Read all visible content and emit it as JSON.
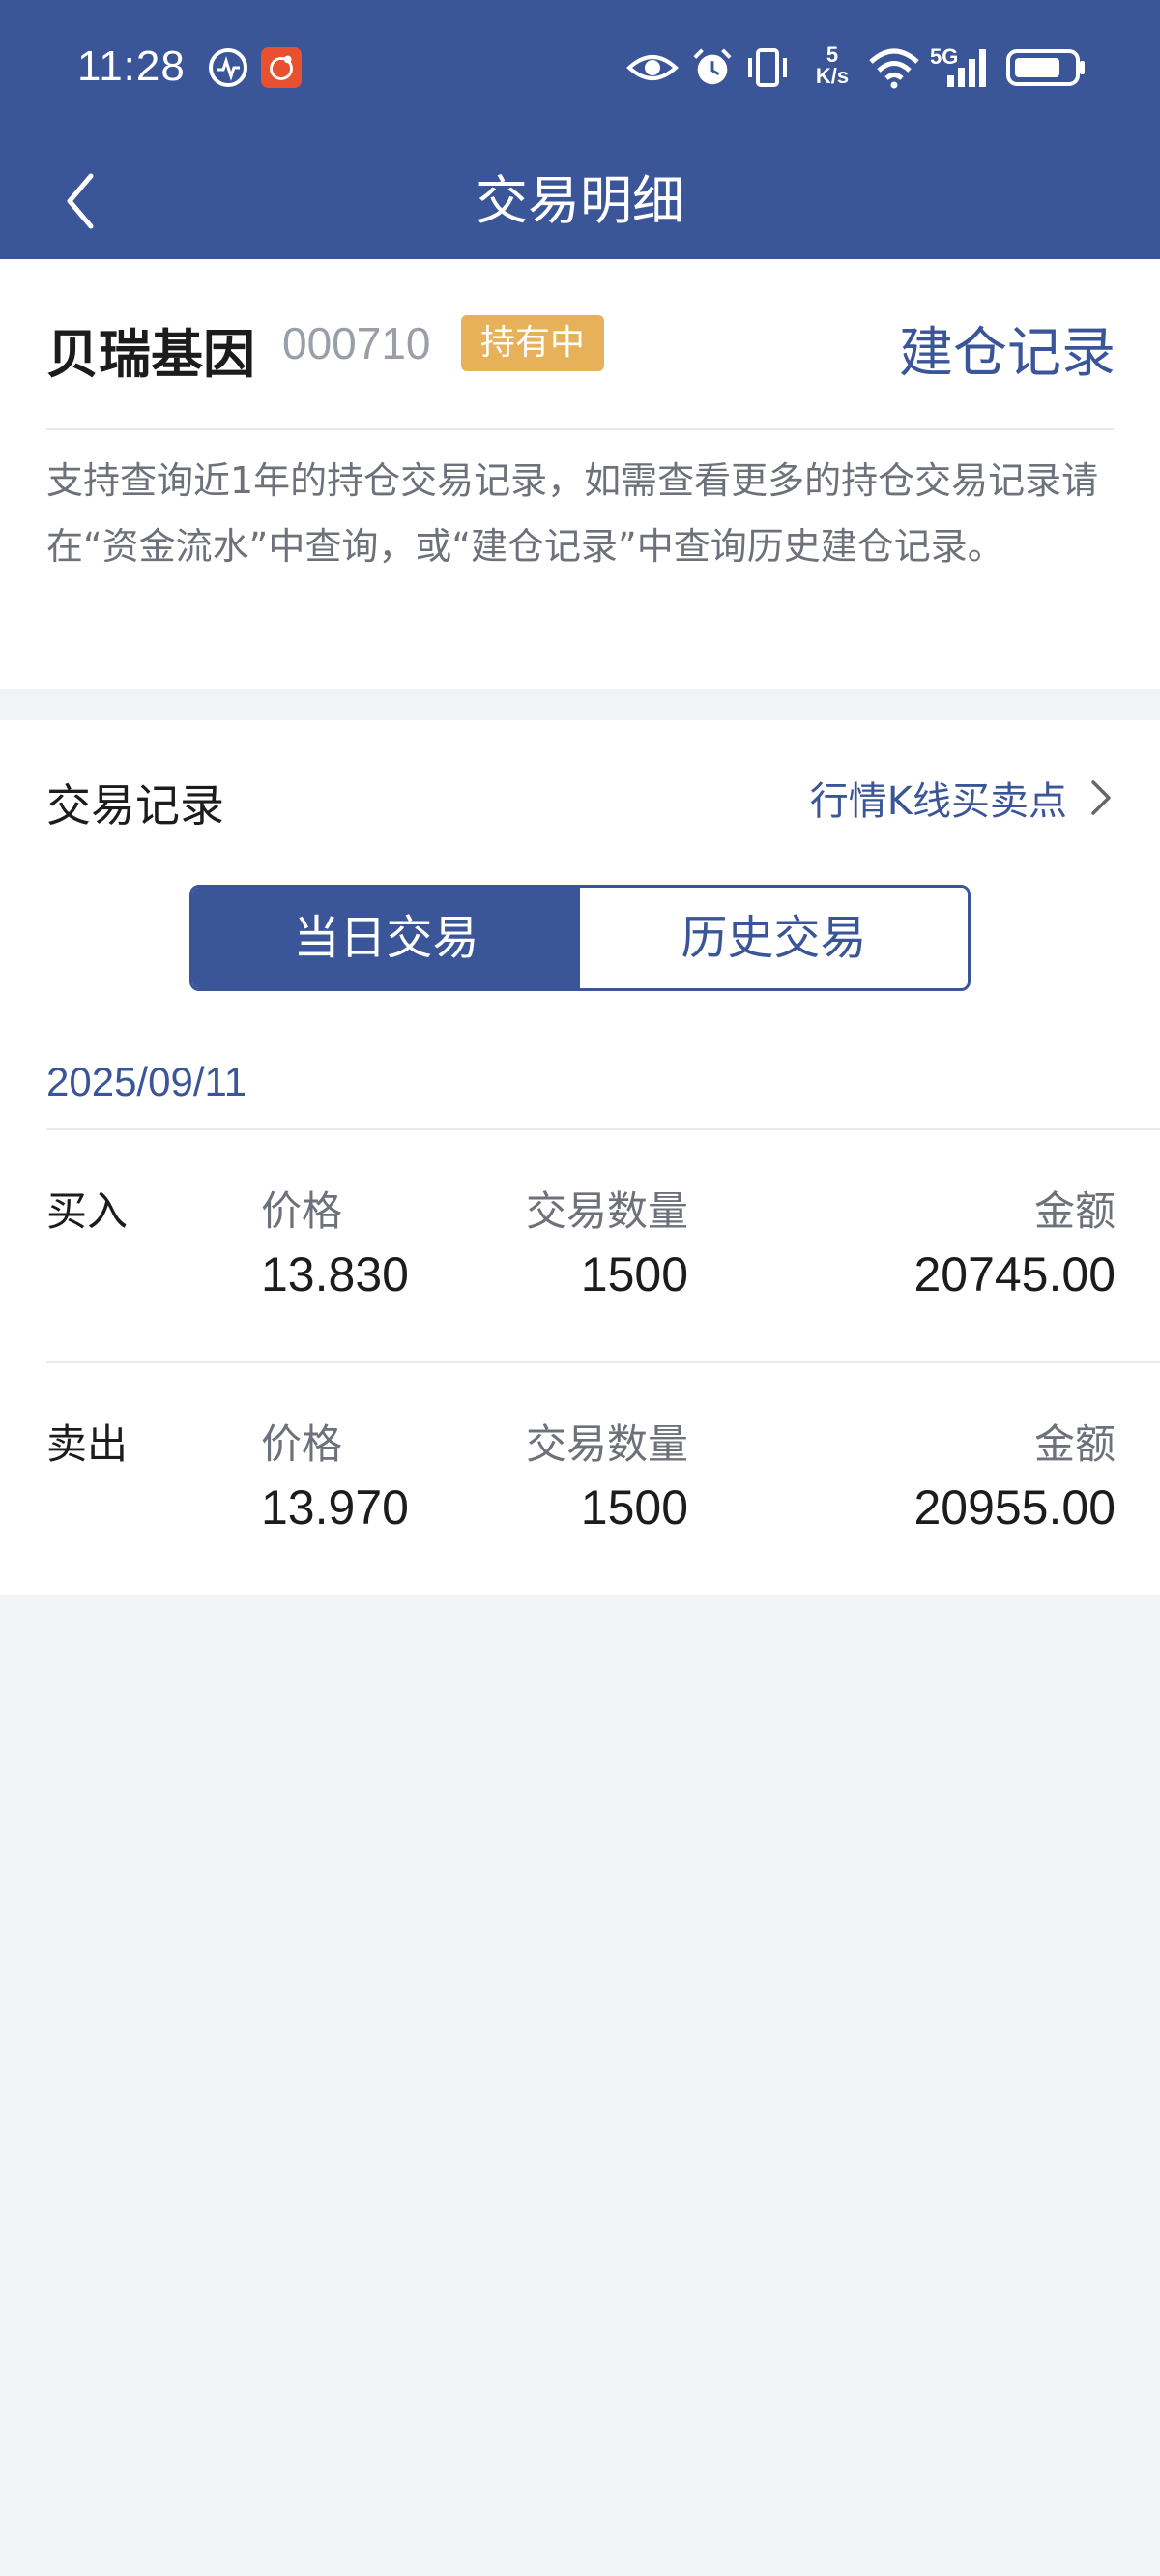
{
  "status_bar": {
    "time": "11:28",
    "net_speed_value": "5",
    "net_speed_unit": "K/s",
    "network": "5G",
    "icons": [
      "activity-icon",
      "app-notification-icon",
      "eye-icon",
      "alarm-icon",
      "vibrate-icon",
      "wifi-icon",
      "signal-icon",
      "battery-icon"
    ]
  },
  "nav": {
    "title": "交易明细",
    "back_icon": "chevron-left-icon"
  },
  "stock": {
    "name": "贝瑞基因",
    "code": "000710",
    "badge": "持有中",
    "build_link": "建仓记录",
    "notice": "支持查询近1年的持仓交易记录，如需查看更多的持仓交易记录请在“资金流水”中查询，或“建仓记录”中查询历史建仓记录。"
  },
  "records": {
    "title": "交易记录",
    "kline_link": "行情K线买卖点",
    "tabs": [
      {
        "label": "当日交易",
        "active": true
      },
      {
        "label": "历史交易",
        "active": false
      }
    ],
    "date": "2025/09/11",
    "columns": {
      "price": "价格",
      "quantity": "交易数量",
      "amount": "金额"
    },
    "trades": [
      {
        "side": "买入",
        "price": "13.830",
        "quantity": "1500",
        "amount": "20745.00"
      },
      {
        "side": "卖出",
        "price": "13.970",
        "quantity": "1500",
        "amount": "20955.00"
      }
    ]
  },
  "colors": {
    "primary": "#3A5598",
    "badge": "#E7B15A",
    "background": "#F2F3F5"
  }
}
